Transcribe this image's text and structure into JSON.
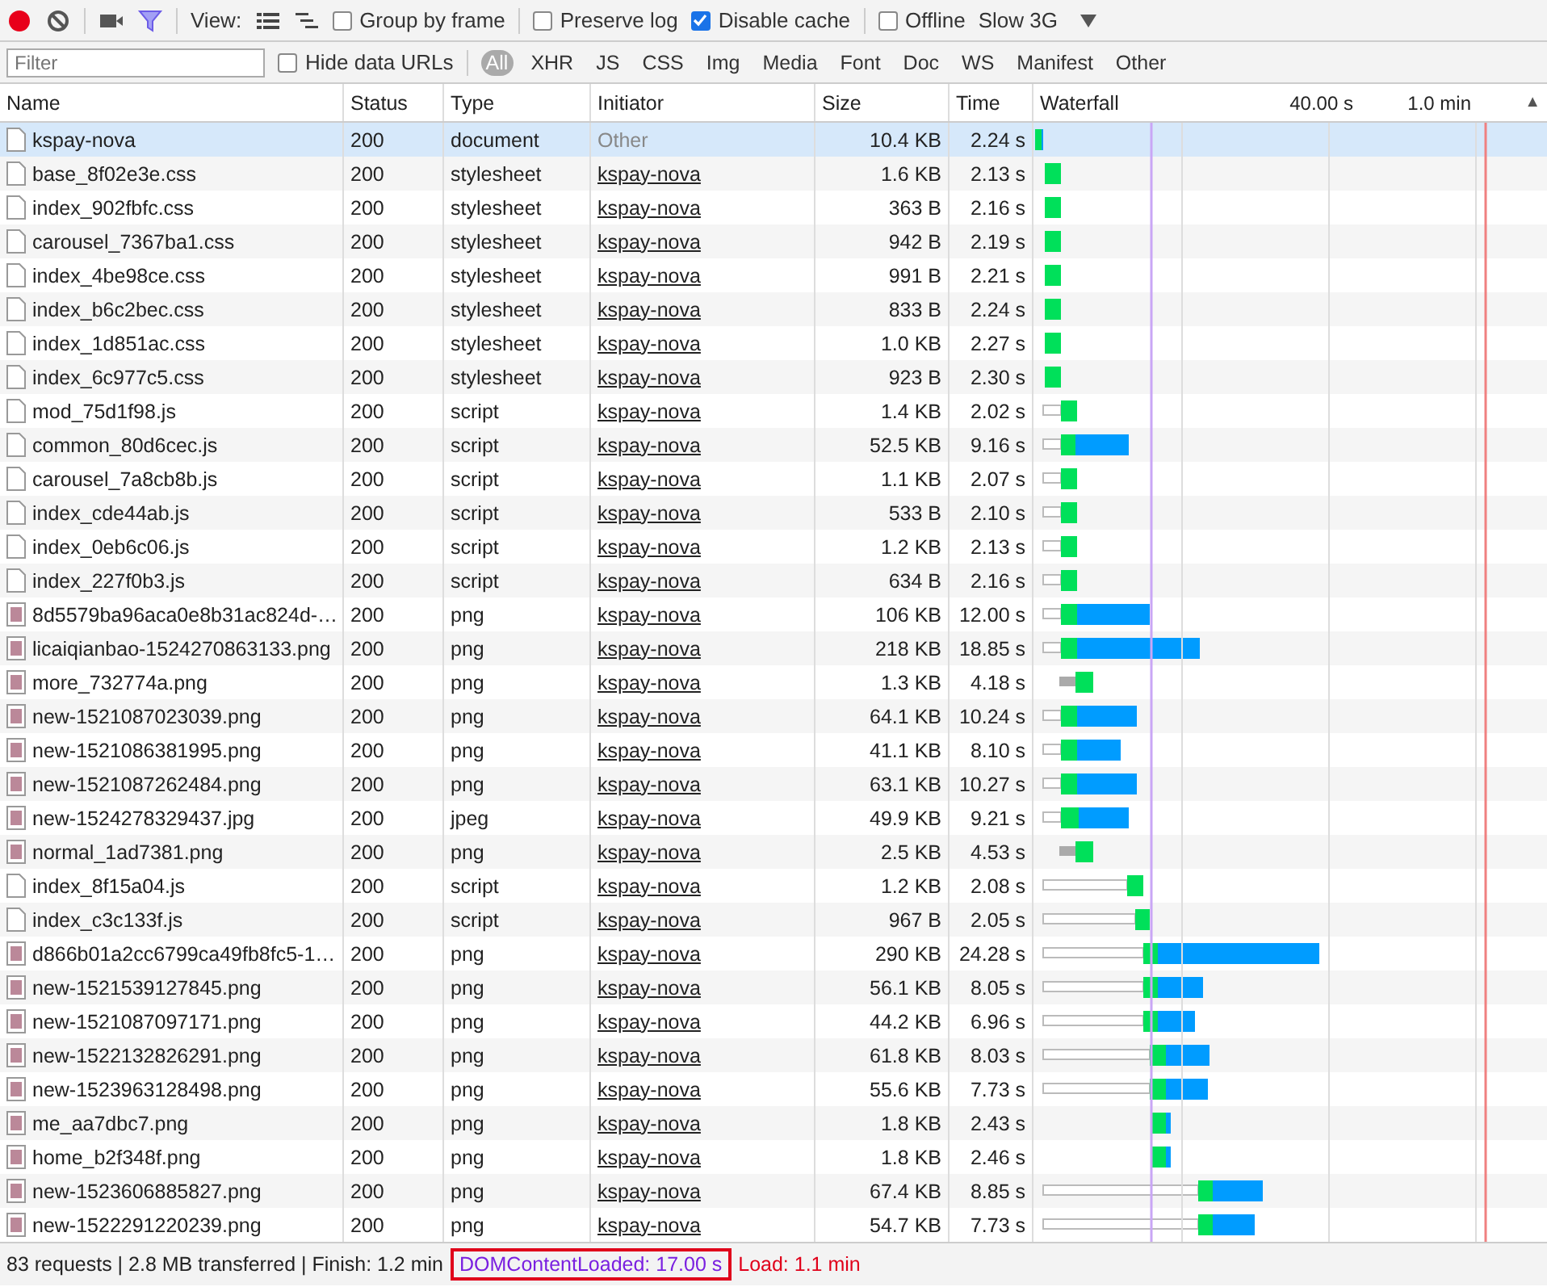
{
  "toolbar": {
    "record": {
      "on": true
    },
    "view_label": "View:",
    "group_by_frame": {
      "label": "Group by frame",
      "checked": false
    },
    "preserve_log": {
      "label": "Preserve log",
      "checked": false
    },
    "disable_cache": {
      "label": "Disable cache",
      "checked": true
    },
    "offline": {
      "label": "Offline",
      "checked": false
    },
    "throttle": "Slow 3G"
  },
  "filter_bar": {
    "placeholder": "Filter",
    "hide_data_urls": {
      "label": "Hide data URLs",
      "checked": false
    },
    "types": [
      {
        "label": "All",
        "selected": true
      },
      {
        "label": "XHR",
        "selected": false
      },
      {
        "label": "JS",
        "selected": false
      },
      {
        "label": "CSS",
        "selected": false
      },
      {
        "label": "Img",
        "selected": false
      },
      {
        "label": "Media",
        "selected": false
      },
      {
        "label": "Font",
        "selected": false
      },
      {
        "label": "Doc",
        "selected": false
      },
      {
        "label": "WS",
        "selected": false
      },
      {
        "label": "Manifest",
        "selected": false
      },
      {
        "label": "Other",
        "selected": false
      }
    ]
  },
  "table": {
    "columns": [
      "Name",
      "Status",
      "Type",
      "Initiator",
      "Size",
      "Time",
      "Waterfall"
    ],
    "timeline_ticks": [
      "40.00 s",
      "1.0 min"
    ],
    "sort_mark": "▲",
    "rows": [
      {
        "name": "kspay-nova",
        "status": "200",
        "type": "document",
        "initiator": {
          "text": "Other",
          "link": false
        },
        "size": "10.4 KB",
        "time": "2.24 s",
        "kind": "file",
        "selected": true
      },
      {
        "name": "base_8f02e3e.css",
        "status": "200",
        "type": "stylesheet",
        "initiator": {
          "text": "kspay-nova",
          "link": true
        },
        "size": "1.6 KB",
        "time": "2.13 s",
        "kind": "file",
        "selected": false
      },
      {
        "name": "index_902fbfc.css",
        "status": "200",
        "type": "stylesheet",
        "initiator": {
          "text": "kspay-nova",
          "link": true
        },
        "size": "363 B",
        "time": "2.16 s",
        "kind": "file",
        "selected": false
      },
      {
        "name": "carousel_7367ba1.css",
        "status": "200",
        "type": "stylesheet",
        "initiator": {
          "text": "kspay-nova",
          "link": true
        },
        "size": "942 B",
        "time": "2.19 s",
        "kind": "file",
        "selected": false
      },
      {
        "name": "index_4be98ce.css",
        "status": "200",
        "type": "stylesheet",
        "initiator": {
          "text": "kspay-nova",
          "link": true
        },
        "size": "991 B",
        "time": "2.21 s",
        "kind": "file",
        "selected": false
      },
      {
        "name": "index_b6c2bec.css",
        "status": "200",
        "type": "stylesheet",
        "initiator": {
          "text": "kspay-nova",
          "link": true
        },
        "size": "833 B",
        "time": "2.24 s",
        "kind": "file",
        "selected": false
      },
      {
        "name": "index_1d851ac.css",
        "status": "200",
        "type": "stylesheet",
        "initiator": {
          "text": "kspay-nova",
          "link": true
        },
        "size": "1.0 KB",
        "time": "2.27 s",
        "kind": "file",
        "selected": false
      },
      {
        "name": "index_6c977c5.css",
        "status": "200",
        "type": "stylesheet",
        "initiator": {
          "text": "kspay-nova",
          "link": true
        },
        "size": "923 B",
        "time": "2.30 s",
        "kind": "file",
        "selected": false
      },
      {
        "name": "mod_75d1f98.js",
        "status": "200",
        "type": "script",
        "initiator": {
          "text": "kspay-nova",
          "link": true
        },
        "size": "1.4 KB",
        "time": "2.02 s",
        "kind": "file",
        "selected": false
      },
      {
        "name": "common_80d6cec.js",
        "status": "200",
        "type": "script",
        "initiator": {
          "text": "kspay-nova",
          "link": true
        },
        "size": "52.5 KB",
        "time": "9.16 s",
        "kind": "file",
        "selected": false
      },
      {
        "name": "carousel_7a8cb8b.js",
        "status": "200",
        "type": "script",
        "initiator": {
          "text": "kspay-nova",
          "link": true
        },
        "size": "1.1 KB",
        "time": "2.07 s",
        "kind": "file",
        "selected": false
      },
      {
        "name": "index_cde44ab.js",
        "status": "200",
        "type": "script",
        "initiator": {
          "text": "kspay-nova",
          "link": true
        },
        "size": "533 B",
        "time": "2.10 s",
        "kind": "file",
        "selected": false
      },
      {
        "name": "index_0eb6c06.js",
        "status": "200",
        "type": "script",
        "initiator": {
          "text": "kspay-nova",
          "link": true
        },
        "size": "1.2 KB",
        "time": "2.13 s",
        "kind": "file",
        "selected": false
      },
      {
        "name": "index_227f0b3.js",
        "status": "200",
        "type": "script",
        "initiator": {
          "text": "kspay-nova",
          "link": true
        },
        "size": "634 B",
        "time": "2.16 s",
        "kind": "file",
        "selected": false
      },
      {
        "name": "8d5579ba96aca0e8b31ac824d-…",
        "status": "200",
        "type": "png",
        "initiator": {
          "text": "kspay-nova",
          "link": true
        },
        "size": "106 KB",
        "time": "12.00 s",
        "kind": "image",
        "selected": false
      },
      {
        "name": "licaiqianbao-1524270863133.png",
        "status": "200",
        "type": "png",
        "initiator": {
          "text": "kspay-nova",
          "link": true
        },
        "size": "218 KB",
        "time": "18.85 s",
        "kind": "image",
        "selected": false
      },
      {
        "name": "more_732774a.png",
        "status": "200",
        "type": "png",
        "initiator": {
          "text": "kspay-nova",
          "link": true
        },
        "size": "1.3 KB",
        "time": "4.18 s",
        "kind": "image",
        "selected": false
      },
      {
        "name": "new-1521087023039.png",
        "status": "200",
        "type": "png",
        "initiator": {
          "text": "kspay-nova",
          "link": true
        },
        "size": "64.1 KB",
        "time": "10.24 s",
        "kind": "image",
        "selected": false
      },
      {
        "name": "new-1521086381995.png",
        "status": "200",
        "type": "png",
        "initiator": {
          "text": "kspay-nova",
          "link": true
        },
        "size": "41.1 KB",
        "time": "8.10 s",
        "kind": "image",
        "selected": false
      },
      {
        "name": "new-1521087262484.png",
        "status": "200",
        "type": "png",
        "initiator": {
          "text": "kspay-nova",
          "link": true
        },
        "size": "63.1 KB",
        "time": "10.27 s",
        "kind": "image",
        "selected": false
      },
      {
        "name": "new-1524278329437.jpg",
        "status": "200",
        "type": "jpeg",
        "initiator": {
          "text": "kspay-nova",
          "link": true
        },
        "size": "49.9 KB",
        "time": "9.21 s",
        "kind": "image",
        "selected": false
      },
      {
        "name": "normal_1ad7381.png",
        "status": "200",
        "type": "png",
        "initiator": {
          "text": "kspay-nova",
          "link": true
        },
        "size": "2.5 KB",
        "time": "4.53 s",
        "kind": "image",
        "selected": false
      },
      {
        "name": "index_8f15a04.js",
        "status": "200",
        "type": "script",
        "initiator": {
          "text": "kspay-nova",
          "link": true
        },
        "size": "1.2 KB",
        "time": "2.08 s",
        "kind": "file",
        "selected": false
      },
      {
        "name": "index_c3c133f.js",
        "status": "200",
        "type": "script",
        "initiator": {
          "text": "kspay-nova",
          "link": true
        },
        "size": "967 B",
        "time": "2.05 s",
        "kind": "file",
        "selected": false
      },
      {
        "name": "d866b01a2cc6799ca49fb8fc5-1…",
        "status": "200",
        "type": "png",
        "initiator": {
          "text": "kspay-nova",
          "link": true
        },
        "size": "290 KB",
        "time": "24.28 s",
        "kind": "image",
        "selected": false
      },
      {
        "name": "new-1521539127845.png",
        "status": "200",
        "type": "png",
        "initiator": {
          "text": "kspay-nova",
          "link": true
        },
        "size": "56.1 KB",
        "time": "8.05 s",
        "kind": "image",
        "selected": false
      },
      {
        "name": "new-1521087097171.png",
        "status": "200",
        "type": "png",
        "initiator": {
          "text": "kspay-nova",
          "link": true
        },
        "size": "44.2 KB",
        "time": "6.96 s",
        "kind": "image",
        "selected": false
      },
      {
        "name": "new-1522132826291.png",
        "status": "200",
        "type": "png",
        "initiator": {
          "text": "kspay-nova",
          "link": true
        },
        "size": "61.8 KB",
        "time": "8.03 s",
        "kind": "image",
        "selected": false
      },
      {
        "name": "new-1523963128498.png",
        "status": "200",
        "type": "png",
        "initiator": {
          "text": "kspay-nova",
          "link": true
        },
        "size": "55.6 KB",
        "time": "7.73 s",
        "kind": "image",
        "selected": false
      },
      {
        "name": "me_aa7dbc7.png",
        "status": "200",
        "type": "png",
        "initiator": {
          "text": "kspay-nova",
          "link": true
        },
        "size": "1.8 KB",
        "time": "2.43 s",
        "kind": "image",
        "selected": false
      },
      {
        "name": "home_b2f348f.png",
        "status": "200",
        "type": "png",
        "initiator": {
          "text": "kspay-nova",
          "link": true
        },
        "size": "1.8 KB",
        "time": "2.46 s",
        "kind": "image",
        "selected": false
      },
      {
        "name": "new-1523606885827.png",
        "status": "200",
        "type": "png",
        "initiator": {
          "text": "kspay-nova",
          "link": true
        },
        "size": "67.4 KB",
        "time": "8.85 s",
        "kind": "image",
        "selected": false
      },
      {
        "name": "new-1522291220239.png",
        "status": "200",
        "type": "png",
        "initiator": {
          "text": "kspay-nova",
          "link": true
        },
        "size": "54.7 KB",
        "time": "7.73 s",
        "kind": "image",
        "selected": false
      }
    ]
  },
  "status_bar": {
    "summary": "83 requests | 2.8 MB transferred | Finish: 1.2 min",
    "dom_content_loaded": "DOMContentLoaded: 17.00 s",
    "load": "Load: 1.1 min"
  }
}
